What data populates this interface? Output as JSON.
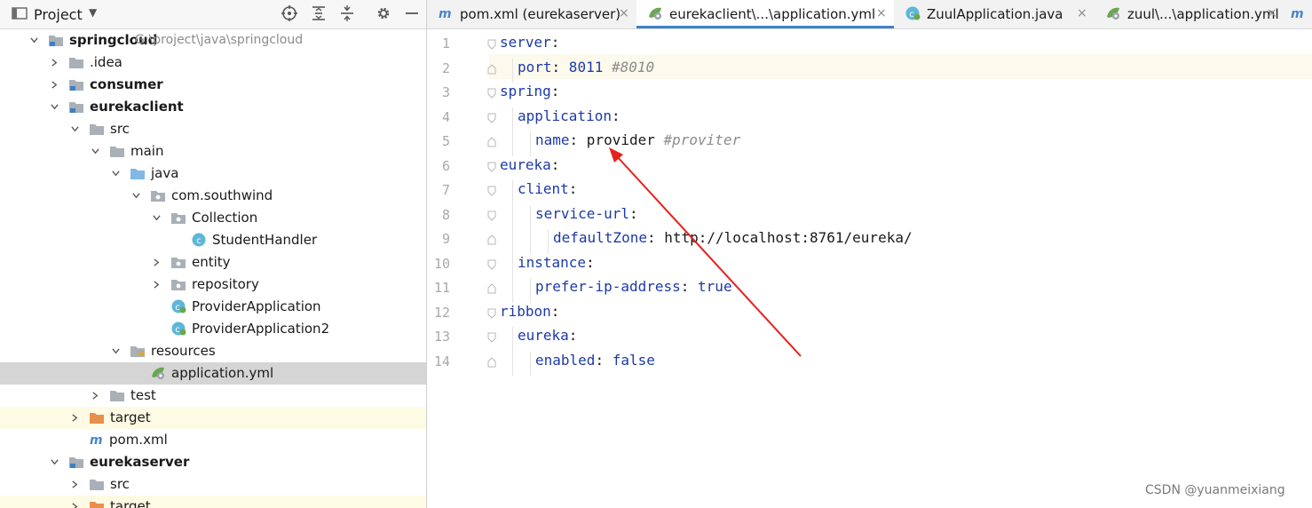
{
  "project_panel": {
    "title": "Project",
    "icons": [
      "locate-icon",
      "expand-all-icon",
      "collapse-all-icon",
      "gear-icon",
      "minimize-icon"
    ],
    "tree": [
      {
        "label": "springcloud",
        "path": "G:\\project\\java\\springcloud",
        "bold": true,
        "depth": 0,
        "arrow": "down",
        "icon": "module-folder"
      },
      {
        "label": ".idea",
        "depth": 1,
        "arrow": "right",
        "icon": "folder"
      },
      {
        "label": "consumer",
        "bold": true,
        "depth": 1,
        "arrow": "right",
        "icon": "module-folder"
      },
      {
        "label": "eurekaclient",
        "bold": true,
        "depth": 1,
        "arrow": "down",
        "icon": "module-folder"
      },
      {
        "label": "src",
        "depth": 2,
        "arrow": "down",
        "icon": "folder"
      },
      {
        "label": "main",
        "depth": 3,
        "arrow": "down",
        "icon": "folder"
      },
      {
        "label": "java",
        "depth": 4,
        "arrow": "down",
        "icon": "source-folder"
      },
      {
        "label": "com.southwind",
        "depth": 5,
        "arrow": "down",
        "icon": "package"
      },
      {
        "label": "Collection",
        "depth": 6,
        "arrow": "down",
        "icon": "package"
      },
      {
        "label": "StudentHandler",
        "depth": 7,
        "arrow": "none",
        "icon": "class"
      },
      {
        "label": "entity",
        "depth": 6,
        "arrow": "right",
        "icon": "package"
      },
      {
        "label": "repository",
        "depth": 6,
        "arrow": "right",
        "icon": "package"
      },
      {
        "label": "ProviderApplication",
        "depth": 6,
        "arrow": "none",
        "icon": "spring-class"
      },
      {
        "label": "ProviderApplication2",
        "depth": 6,
        "arrow": "none",
        "icon": "spring-class"
      },
      {
        "label": "resources",
        "depth": 4,
        "arrow": "down",
        "icon": "resources-folder"
      },
      {
        "label": "application.yml",
        "depth": 5,
        "arrow": "none",
        "icon": "yml",
        "highlight": "selected"
      },
      {
        "label": "test",
        "depth": 3,
        "arrow": "right",
        "icon": "folder"
      },
      {
        "label": "target",
        "depth": 2,
        "arrow": "right",
        "icon": "excluded-folder",
        "highlight": "yellow"
      },
      {
        "label": "pom.xml",
        "depth": 2,
        "arrow": "none",
        "icon": "maven"
      },
      {
        "label": "eurekaserver",
        "bold": true,
        "depth": 1,
        "arrow": "down",
        "icon": "module-folder"
      },
      {
        "label": "src",
        "depth": 2,
        "arrow": "right",
        "icon": "folder"
      },
      {
        "label": "target",
        "depth": 2,
        "arrow": "right",
        "icon": "excluded-folder",
        "highlight": "yellow"
      }
    ]
  },
  "tabs": [
    {
      "label": "pom.xml (eurekaserver)",
      "icon": "maven-icon",
      "active": false
    },
    {
      "label": "eurekaclient\\...\\application.yml",
      "icon": "yml-icon",
      "active": true
    },
    {
      "label": "ZuulApplication.java",
      "icon": "spring-class-icon",
      "active": false
    },
    {
      "label": "zuul\\...\\application.yml",
      "icon": "yml-icon",
      "active": false
    }
  ],
  "tab_overflow_icon": "maven-icon",
  "editor": {
    "current_line": 2,
    "lines": [
      {
        "n": "1",
        "indent": 0,
        "key": "server",
        "value": "",
        "comment": "",
        "vtype": ""
      },
      {
        "n": "2",
        "indent": 1,
        "key": "port",
        "value": "8011",
        "comment": "#8010",
        "vtype": "num"
      },
      {
        "n": "3",
        "indent": 0,
        "key": "spring",
        "value": "",
        "comment": "",
        "vtype": ""
      },
      {
        "n": "4",
        "indent": 1,
        "key": "application",
        "value": "",
        "comment": "",
        "vtype": ""
      },
      {
        "n": "5",
        "indent": 2,
        "key": "name",
        "value": "provider",
        "comment": "#proviter",
        "vtype": "str"
      },
      {
        "n": "6",
        "indent": 0,
        "key": "eureka",
        "value": "",
        "comment": "",
        "vtype": ""
      },
      {
        "n": "7",
        "indent": 1,
        "key": "client",
        "value": "",
        "comment": "",
        "vtype": ""
      },
      {
        "n": "8",
        "indent": 2,
        "key": "service-url",
        "value": "",
        "comment": "",
        "vtype": ""
      },
      {
        "n": "9",
        "indent": 3,
        "key": "defaultZone",
        "value": "http://localhost:8761/eureka/",
        "comment": "",
        "vtype": "str"
      },
      {
        "n": "10",
        "indent": 1,
        "key": "instance",
        "value": "",
        "comment": "",
        "vtype": ""
      },
      {
        "n": "11",
        "indent": 2,
        "key": "prefer-ip-address",
        "value": "true",
        "comment": "",
        "vtype": "bool"
      },
      {
        "n": "12",
        "indent": 0,
        "key": "ribbon",
        "value": "",
        "comment": "",
        "vtype": ""
      },
      {
        "n": "13",
        "indent": 1,
        "key": "eureka",
        "value": "",
        "comment": "",
        "vtype": ""
      },
      {
        "n": "14",
        "indent": 2,
        "key": "enabled",
        "value": "false",
        "comment": "",
        "vtype": "bool"
      }
    ]
  },
  "annotation": {
    "type": "arrow",
    "color": "#e8201a"
  },
  "watermark": "CSDN @yuanmeixiang"
}
